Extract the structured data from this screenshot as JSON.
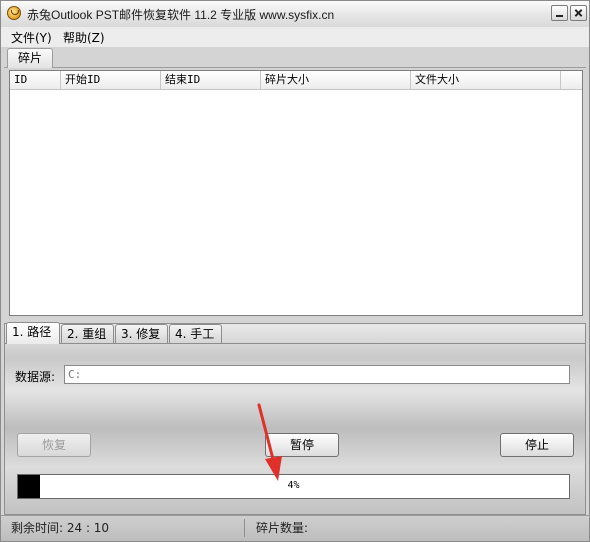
{
  "window": {
    "title": "赤兔Outlook PST邮件恢复软件 11.2 专业版 www.sysfix.cn",
    "minimize_icon": "minimize-icon",
    "close_icon": "close-icon"
  },
  "menu": {
    "file": "文件(Y)",
    "help": "帮助(Z)"
  },
  "top_tab": {
    "label": "碎片"
  },
  "fragment_table": {
    "columns": [
      "ID",
      "开始ID",
      "结束ID",
      "碎片大小",
      "文件大小"
    ],
    "rows": []
  },
  "steps": {
    "tabs": [
      "1. 路径",
      "2. 重组",
      "3. 修复",
      "4. 手工"
    ],
    "active_index": 0
  },
  "source": {
    "label": "数据源:",
    "value": "C:"
  },
  "buttons": {
    "recover": "恢复",
    "pause": "暂停",
    "stop": "停止"
  },
  "progress": {
    "percent": 4,
    "label": "4%"
  },
  "status": {
    "remaining_time": "剩余时间: 24 : 10",
    "fragment_count": "碎片数量:"
  },
  "colors": {
    "annotation_arrow": "#e0302a",
    "progress_fill": "#000000"
  }
}
